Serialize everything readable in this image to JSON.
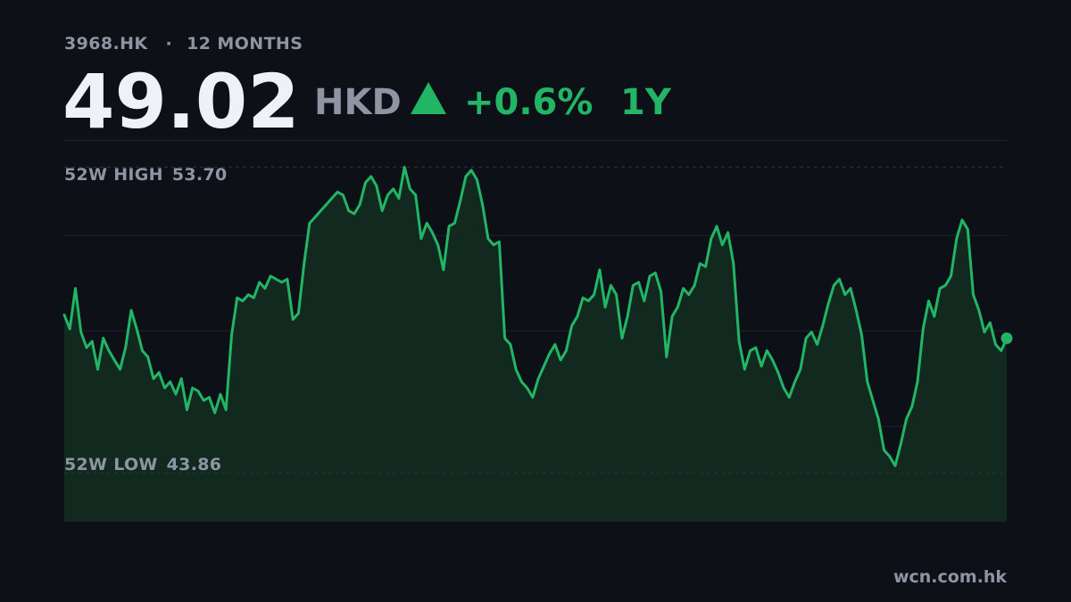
{
  "header": {
    "ticker": "3968.HK",
    "separator": "·",
    "range_label": "12 MONTHS",
    "price": "49.02",
    "currency": "HKD",
    "change": "+0.6%",
    "period": "1Y"
  },
  "labels": {
    "high_label": "52W HIGH",
    "high_value": "53.70",
    "low_label": "52W LOW",
    "low_value": "43.86"
  },
  "footer": {
    "source": "wcn.com.hk"
  },
  "colors": {
    "background": "#0d1017",
    "line": "#22b565",
    "area_fill": "#12291f",
    "muted_text": "#8d95a3",
    "price_text": "#eef1f7"
  },
  "chart_data": {
    "type": "area",
    "title": "",
    "xlabel": "",
    "ylabel": "",
    "ylim": [
      42.3,
      54.2
    ],
    "grid": true,
    "reference_lines": [
      {
        "label": "52W HIGH",
        "value": 53.7
      },
      {
        "label": "52W LOW",
        "value": 43.86
      }
    ],
    "series": [
      {
        "values": [
          48.95,
          48.5,
          49.8,
          48.4,
          47.9,
          48.1,
          47.2,
          48.2,
          47.8,
          47.5,
          47.2,
          47.9,
          49.1,
          48.5,
          47.8,
          47.6,
          46.9,
          47.1,
          46.6,
          46.8,
          46.4,
          46.9,
          45.9,
          46.6,
          46.5,
          46.2,
          46.3,
          45.8,
          46.4,
          45.9,
          48.3,
          49.5,
          49.4,
          49.6,
          49.5,
          50.0,
          49.8,
          50.2,
          50.1,
          50.0,
          50.1,
          48.8,
          49.0,
          50.6,
          51.9,
          52.1,
          52.3,
          52.5,
          52.7,
          52.9,
          52.8,
          52.3,
          52.2,
          52.5,
          53.2,
          53.4,
          53.1,
          52.3,
          52.8,
          53.0,
          52.7,
          53.7,
          53.0,
          52.8,
          51.4,
          51.9,
          51.6,
          51.2,
          50.4,
          51.8,
          51.9,
          52.6,
          53.4,
          53.6,
          53.3,
          52.5,
          51.4,
          51.2,
          51.3,
          48.2,
          48.0,
          47.2,
          46.8,
          46.6,
          46.3,
          46.9,
          47.3,
          47.7,
          48.0,
          47.5,
          47.8,
          48.6,
          48.9,
          49.5,
          49.4,
          49.6,
          50.4,
          49.2,
          49.9,
          49.6,
          48.2,
          48.9,
          49.9,
          50.0,
          49.4,
          50.2,
          50.3,
          49.7,
          47.6,
          48.9,
          49.2,
          49.8,
          49.6,
          49.9,
          50.6,
          50.5,
          51.4,
          51.8,
          51.2,
          51.6,
          50.6,
          48.1,
          47.2,
          47.8,
          47.9,
          47.3,
          47.8,
          47.5,
          47.1,
          46.6,
          46.3,
          46.8,
          47.2,
          48.2,
          48.4,
          48.0,
          48.6,
          49.3,
          49.9,
          50.1,
          49.6,
          49.8,
          49.1,
          48.3,
          46.8,
          46.2,
          45.6,
          44.6,
          44.4,
          44.1,
          44.8,
          45.6,
          46.0,
          46.8,
          48.5,
          49.4,
          48.9,
          49.8,
          49.9,
          50.2,
          51.4,
          52.0,
          51.7,
          49.6,
          49.1,
          48.4,
          48.7,
          48.0,
          47.8,
          48.2
        ]
      }
    ]
  }
}
